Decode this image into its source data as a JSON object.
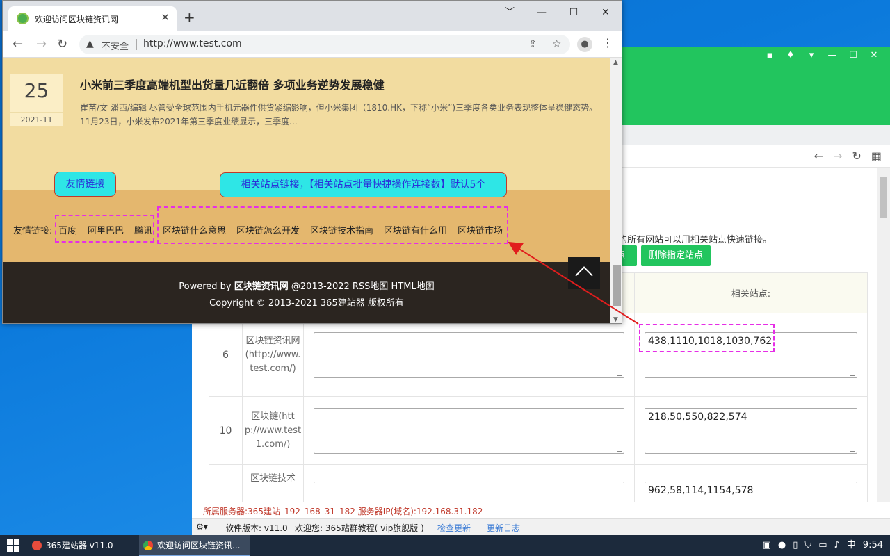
{
  "background_app": {
    "description_tail": "锩的所有网站可以用相关站点快速链接。",
    "partial_button_label": "点",
    "delete_button_label": "删除指定站点",
    "table": {
      "related_header": "相关站点:",
      "rows": [
        {
          "num": "6",
          "site": "区块链资讯网(http://www.test.com/)",
          "area": "",
          "related": "438,1110,1018,1030,762"
        },
        {
          "num": "10",
          "site": "区块链(http://www.test1.com/)",
          "area": "",
          "related": "218,50,550,822,574"
        },
        {
          "num": "",
          "site": "区块链技术",
          "area": "",
          "related": "962,58,114,1154,578"
        }
      ]
    },
    "status_line": "所属服务器:365建站_192_168_31_182 服务器IP(域名):192.168.31.182",
    "footer": {
      "version": "软件版本: v11.0",
      "welcome": "欢迎您: 365站群教程( vip旗舰版 )",
      "check_update": "检查更新",
      "update_log": "更新日志"
    }
  },
  "browser": {
    "tab_title": "欢迎访问区块链资讯网",
    "new_tab": "+",
    "insecure_label": "不安全",
    "url": "http://www.test.com",
    "window_controls": [
      "﹀",
      "—",
      "☐",
      "✕"
    ]
  },
  "page": {
    "article": {
      "day": "25",
      "year_month": "2021-11",
      "title": "小米前三季度高端机型出货量几近翻倍 多项业务逆势发展稳健",
      "summary": "崔苗/文 潘西/编辑 尽管受全球范围内手机元器件供货紧缩影响，但小米集团（1810.HK，下称“小米”)三季度各类业务表现整体呈稳健态势。 11月23日，小米发布2021年第三季度业绩显示，三季度..."
    },
    "links": {
      "label": "友情链接:",
      "friend_links": [
        "百度",
        "阿里巴巴",
        "腾讯"
      ],
      "related_links": [
        "区块链什么意思",
        "区块链怎么开发",
        "区块链技术指南",
        "区块链有什么用",
        "区块链市场"
      ]
    },
    "footer": {
      "line1_prefix": "Powered by ",
      "site_name": "区块链资讯网",
      "line1_suffix": " @2013-2022 RSS地图 HTML地图",
      "line2": "Copyright © 2013-2021 365建站器 版权所有"
    }
  },
  "annotations": {
    "friend_callout": "友情链接",
    "related_callout": "相关站点链接，【相关站点批量快捷操作连接数】默认5个"
  },
  "taskbar": {
    "app1": "365建站器 v11.0",
    "app2": "欢迎访问区块链资讯...",
    "ime": "中",
    "time": "9:54"
  },
  "colors": {
    "accent_green": "#22c55e",
    "annotation_magenta": "#e62ee6",
    "arrow_red": "#e11d1d",
    "callout_cyan": "#2ee6e6"
  }
}
